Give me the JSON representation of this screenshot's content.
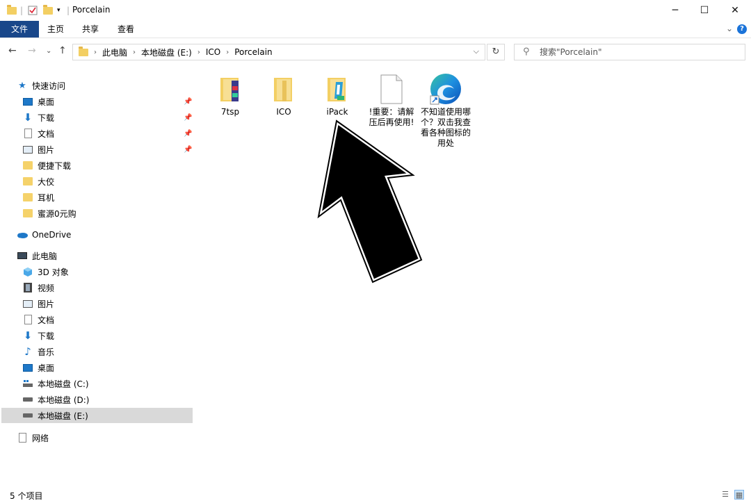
{
  "window": {
    "title": "Porcelain",
    "minimize_icon": "minimize-icon",
    "maximize_icon": "maximize-icon",
    "close_icon": "close-icon"
  },
  "ribbon": {
    "tabs": [
      "文件",
      "主页",
      "共享",
      "查看"
    ],
    "active": "文件",
    "colors": {
      "file_tab": "#19478a"
    }
  },
  "address": {
    "crumbs": [
      "此电脑",
      "本地磁盘 (E:)",
      "ICO",
      "Porcelain"
    ],
    "search_placeholder": "搜索\"Porcelain\""
  },
  "sidebar": {
    "quick_access": "快速访问",
    "quick_items": [
      "桌面",
      "下载",
      "文档",
      "图片",
      "便捷下载",
      "大佼",
      "耳机",
      "蜜源0元购"
    ],
    "onedrive": "OneDrive",
    "this_pc": "此电脑",
    "pc_items": [
      "3D 对象",
      "视频",
      "图片",
      "文档",
      "下载",
      "音乐",
      "桌面",
      "本地磁盘 (C:)",
      "本地磁盘 (D:)",
      "本地磁盘 (E:)"
    ],
    "selected": "本地磁盘 (E:)",
    "network": "网络"
  },
  "files": [
    {
      "name": "7tsp",
      "icon": "folder-icon"
    },
    {
      "name": "ICO",
      "icon": "folder-icon"
    },
    {
      "name": "iPack",
      "icon": "folder-icon"
    },
    {
      "name": "!重要：请解压后再使用!",
      "icon": "text-file-icon"
    },
    {
      "name": "不知道使用哪个？双击我查看各种图标的用处",
      "icon": "edge-shortcut-icon"
    }
  ],
  "status": {
    "count": "5 个项目"
  }
}
